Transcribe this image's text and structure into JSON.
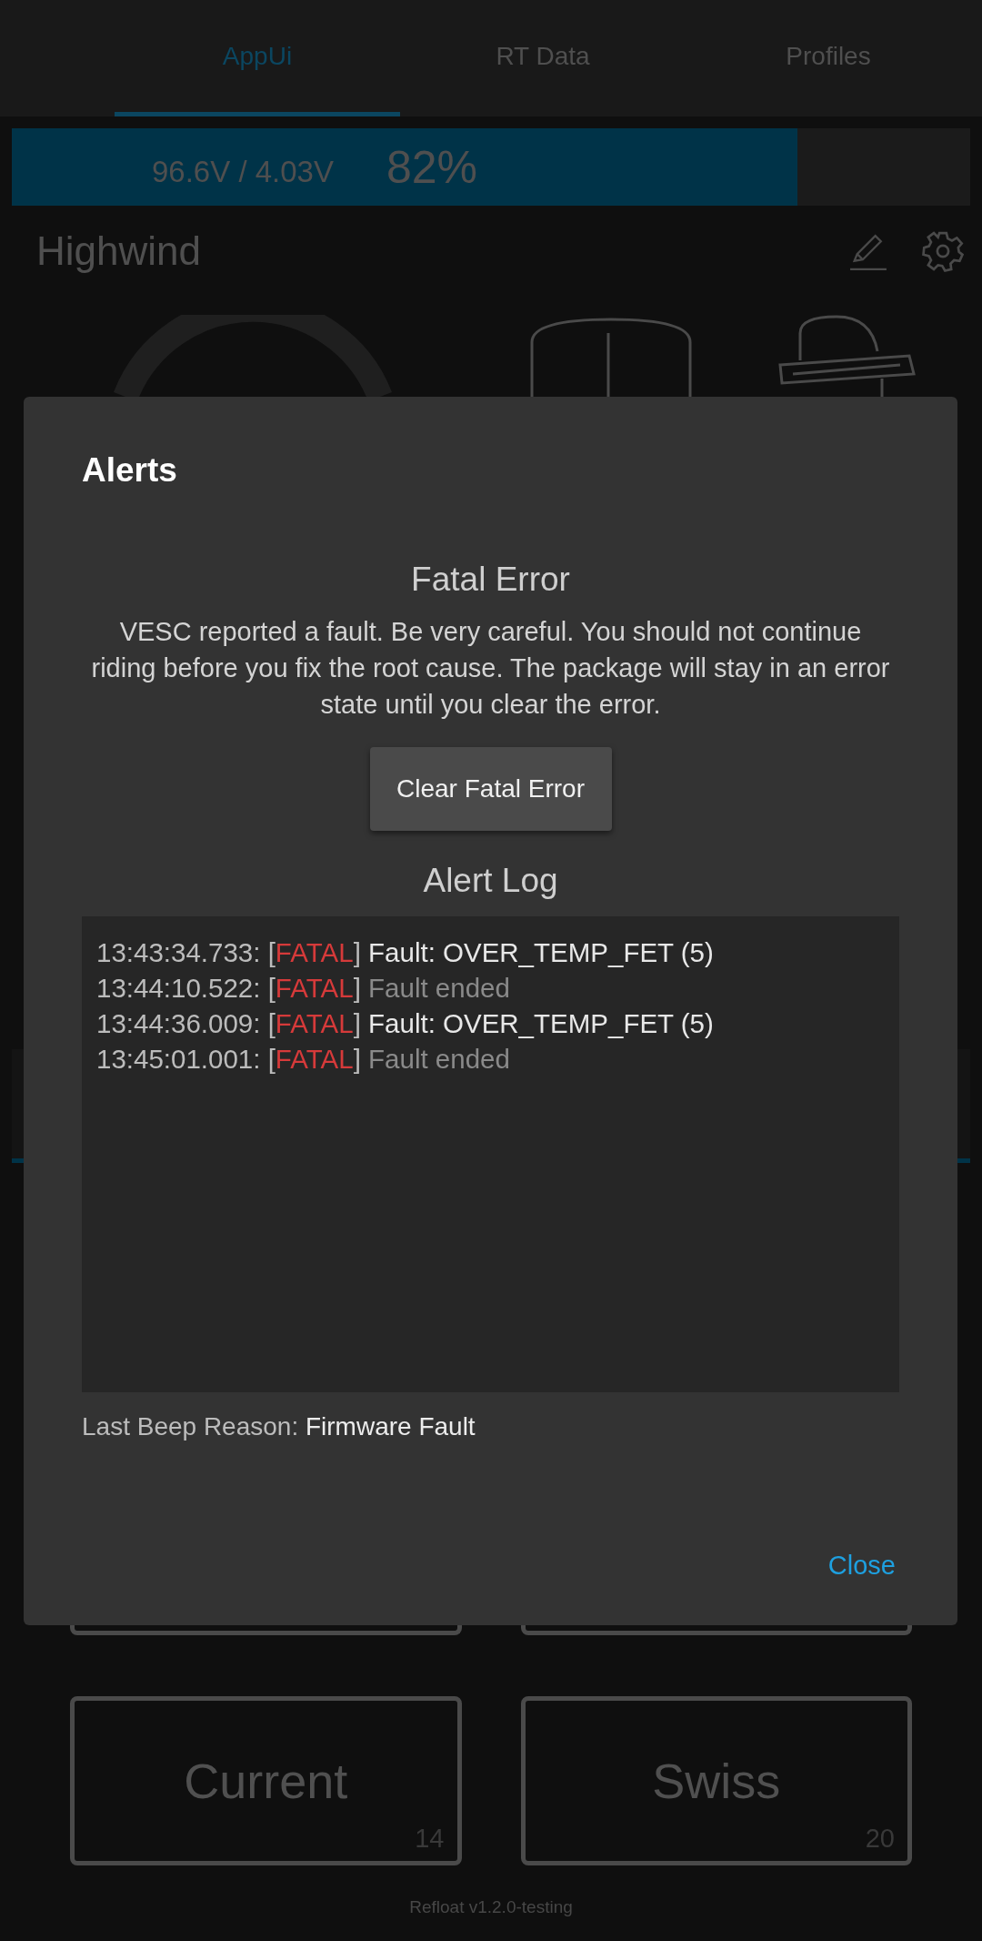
{
  "tabs": [
    {
      "label": "AppUi",
      "selected": true
    },
    {
      "label": "RT Data",
      "selected": false
    },
    {
      "label": "Profiles",
      "selected": false
    }
  ],
  "battery": {
    "voltage": "96.6V / 4.03V",
    "percent": "82%",
    "level": 0.82
  },
  "board": {
    "name": "Highwind"
  },
  "profiles": [
    {
      "name": "Current",
      "number": "14"
    },
    {
      "name": "Swiss",
      "number": "20"
    }
  ],
  "footer": "Refloat v1.2.0-testing",
  "dialog": {
    "title": "Alerts",
    "heading": "Fatal Error",
    "message": "VESC reported a fault. Be very careful. You should not continue riding before you fix the root cause. The package will stay in an error state until you clear the error.",
    "clear_button": "Clear Fatal Error",
    "log_title": "Alert Log",
    "log": [
      {
        "time": "13:43:34.733:",
        "open": "[",
        "level": "FATAL",
        "close": "]",
        "message": "Fault: OVER_TEMP_FET (5)",
        "kind": "fault"
      },
      {
        "time": "13:44:10.522:",
        "open": "[",
        "level": "FATAL",
        "close": "]",
        "message": "Fault ended",
        "kind": "ended"
      },
      {
        "time": "13:44:36.009:",
        "open": "[",
        "level": "FATAL",
        "close": "]",
        "message": "Fault: OVER_TEMP_FET (5)",
        "kind": "fault"
      },
      {
        "time": "13:45:01.001:",
        "open": "[",
        "level": "FATAL",
        "close": "]",
        "message": "Fault ended",
        "kind": "ended"
      }
    ],
    "beep_label": "Last Beep Reason:",
    "beep_value": "Firmware Fault",
    "close_button": "Close"
  }
}
